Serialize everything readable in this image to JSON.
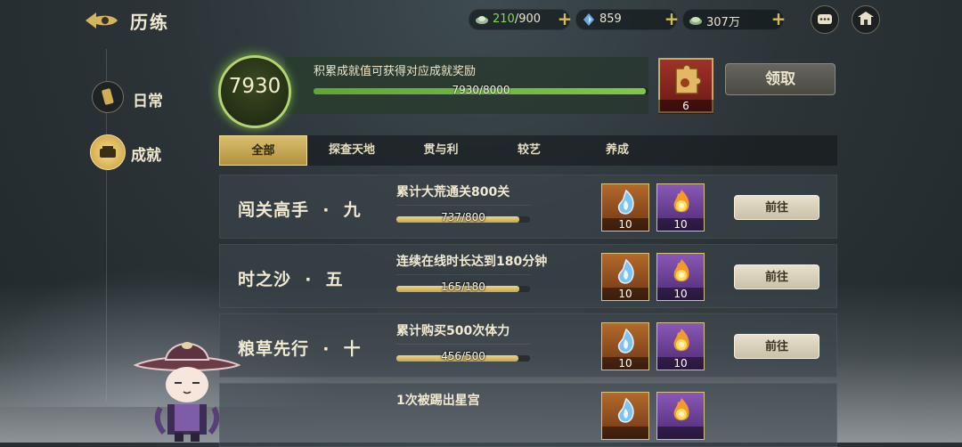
{
  "header": {
    "title": "历练",
    "resources": [
      {
        "icon": "stamina-icon",
        "value_current": "210",
        "value_max": "/900"
      },
      {
        "icon": "gem-icon",
        "value": "859"
      },
      {
        "icon": "coin-icon",
        "value": "307万"
      }
    ]
  },
  "sidebar": {
    "items": [
      {
        "label": "日常",
        "active": false
      },
      {
        "label": "成就",
        "active": true
      }
    ]
  },
  "banner": {
    "score": "7930",
    "description": "积累成就值可获得对应成就奖励",
    "progress_text": "7930/8000",
    "progress_fraction": 0.99125,
    "reward_count": "6",
    "claim_label": "领取"
  },
  "tabs": [
    {
      "label": "全部",
      "active": true
    },
    {
      "label": "探查天地",
      "active": false
    },
    {
      "label": "贯与利",
      "active": false
    },
    {
      "label": "较艺",
      "active": false
    },
    {
      "label": "养成",
      "active": false
    }
  ],
  "achievements": [
    {
      "name": "闯关高手  ·  九",
      "desc": "累计大荒通关800关",
      "progress_text": "737/800",
      "progress_fraction": 0.92125,
      "rewards": [
        {
          "icon": "blue-flame-icon",
          "count": "10"
        },
        {
          "icon": "fire-orb-icon",
          "count": "10"
        }
      ],
      "button": "前往"
    },
    {
      "name": "时之沙  ·  五",
      "desc": "连续在线时长达到180分钟",
      "progress_text": "165/180",
      "progress_fraction": 0.9167,
      "rewards": [
        {
          "icon": "blue-flame-icon",
          "count": "10"
        },
        {
          "icon": "fire-orb-icon",
          "count": "10"
        }
      ],
      "button": "前往"
    },
    {
      "name": "粮草先行  ·  十",
      "desc": "累计购买500次体力",
      "progress_text": "456/500",
      "progress_fraction": 0.912,
      "rewards": [
        {
          "icon": "blue-flame-icon",
          "count": "10"
        },
        {
          "icon": "fire-orb-icon",
          "count": "10"
        }
      ],
      "button": "前往"
    },
    {
      "name": "",
      "desc": "1次被踢出星宫",
      "progress_text": "",
      "progress_fraction": 0,
      "rewards": [
        {
          "icon": "blue-flame-icon",
          "count": ""
        },
        {
          "icon": "fire-orb-icon",
          "count": ""
        }
      ],
      "button": ""
    }
  ],
  "colors": {
    "accent_gold": "#d9be6f",
    "progress_green": "#7ec84a",
    "stamina_green": "#7fdc4c"
  }
}
